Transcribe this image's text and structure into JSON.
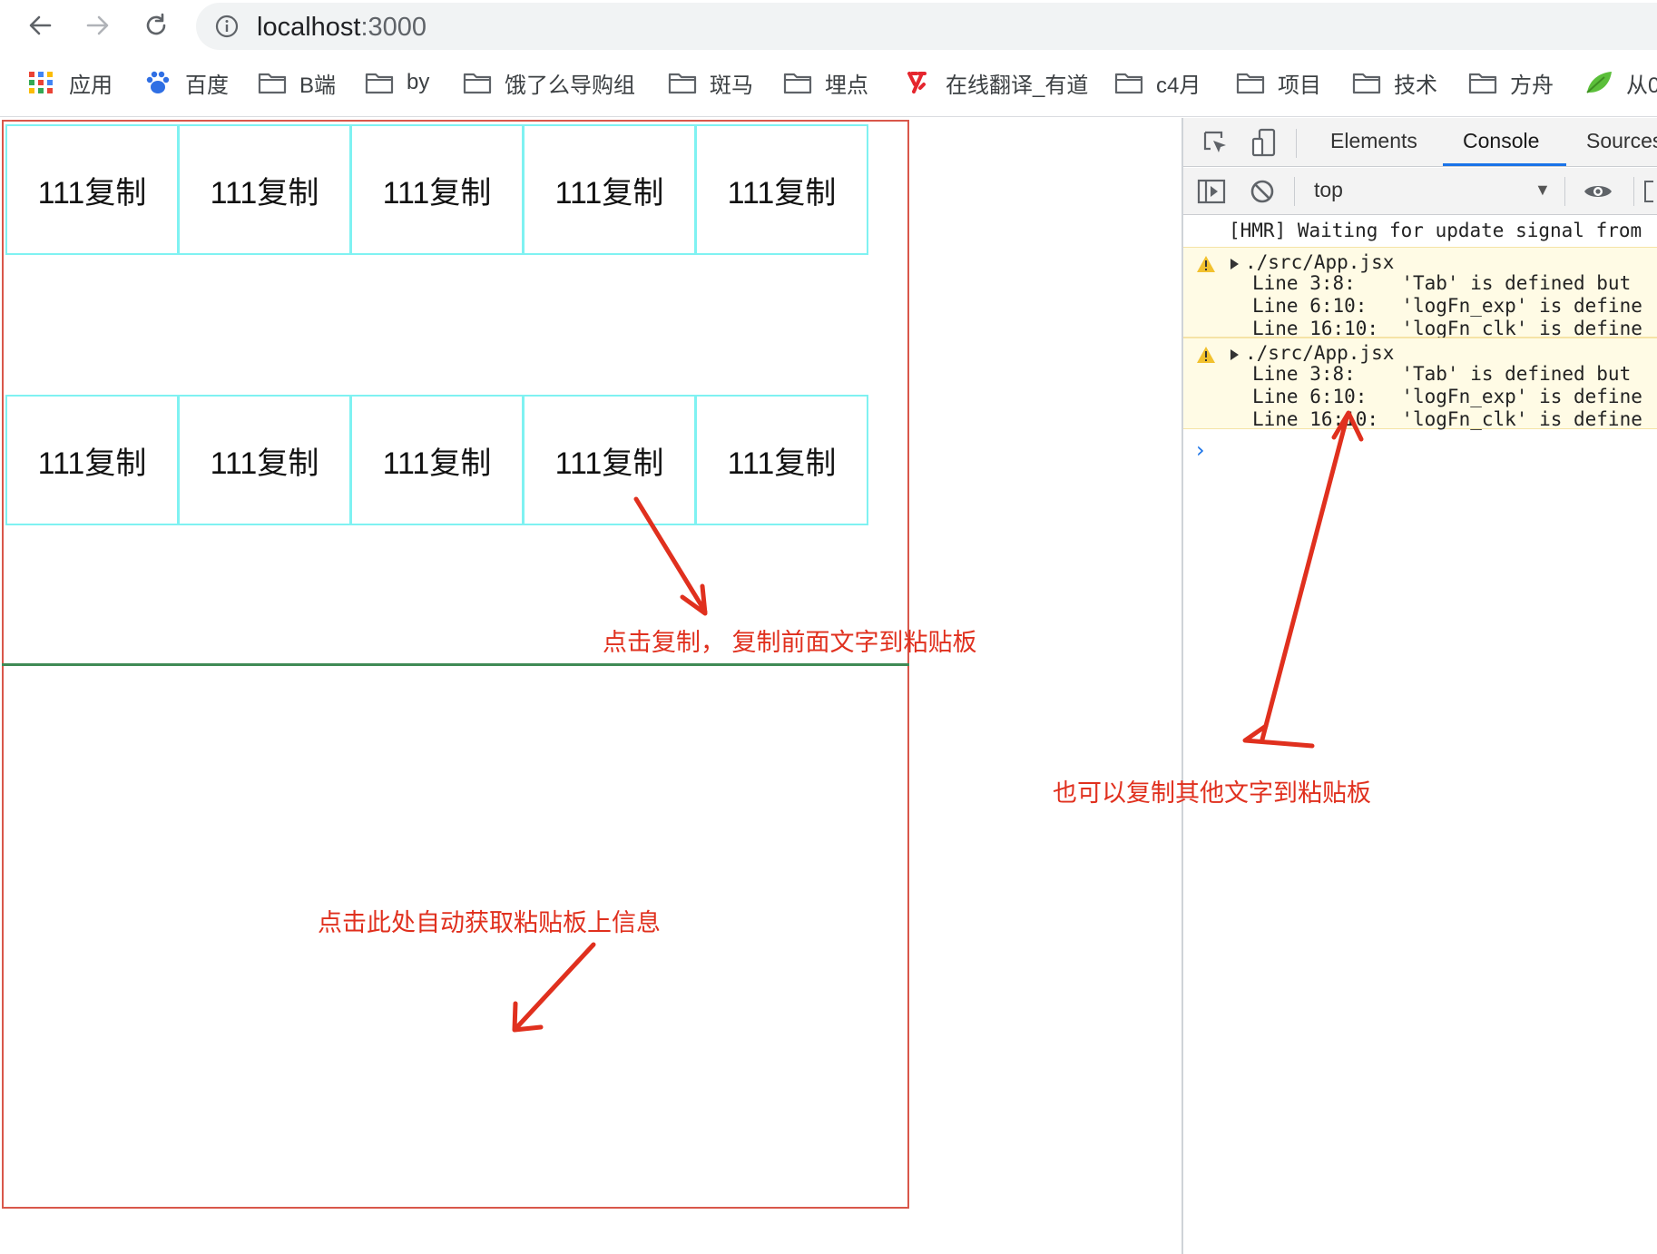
{
  "browser": {
    "url_host": "localhost",
    "url_port": ":3000",
    "nav_icons": [
      "back-arrow-icon",
      "forward-arrow-icon",
      "reload-icon",
      "info-icon"
    ],
    "bookmarks": [
      {
        "label": "应用",
        "icon": "apps-grid-icon"
      },
      {
        "label": "百度",
        "icon": "baidu-paw-icon"
      },
      {
        "label": "B端",
        "icon": "folder-icon"
      },
      {
        "label": "by",
        "icon": "folder-icon"
      },
      {
        "label": "饿了么导购组",
        "icon": "folder-icon"
      },
      {
        "label": "斑马",
        "icon": "folder-icon"
      },
      {
        "label": "埋点",
        "icon": "folder-icon"
      },
      {
        "label": "在线翻译_有道",
        "icon": "youdao-icon"
      },
      {
        "label": "c4月",
        "icon": "folder-icon"
      },
      {
        "label": "项目",
        "icon": "folder-icon"
      },
      {
        "label": "技术",
        "icon": "folder-icon"
      },
      {
        "label": "方舟",
        "icon": "folder-icon"
      },
      {
        "label": "从0",
        "icon": "leaf-icon"
      }
    ]
  },
  "app": {
    "rows": [
      [
        "111复制",
        "111复制",
        "111复制",
        "111复制",
        "111复制"
      ],
      [
        "111复制",
        "111复制",
        "111复制",
        "111复制",
        "111复制"
      ]
    ]
  },
  "devtools": {
    "tabs": [
      "Elements",
      "Console",
      "Sources"
    ],
    "active_tab": "Console",
    "context": "top",
    "log": "[HMR] Waiting for update signal from",
    "warnings": [
      {
        "file": "./src/App.jsx",
        "lines": [
          "Line 3:8:    'Tab' is defined but",
          "Line 6:10:   'logFn_exp' is define",
          "Line 16:10:  'logFn_clk' is define"
        ]
      },
      {
        "file": "./src/App.jsx",
        "lines": [
          "Line 3:8:    'Tab' is defined but",
          "Line 6:10:   'logFn_exp' is define",
          "Line 16:10:  'logFn_clk' is define"
        ]
      }
    ],
    "prompt": "›"
  },
  "annotations": {
    "copy_hint": "点击复制， 复制前面文字到粘贴板",
    "other_copy_hint": "也可以复制其他文字到粘贴板",
    "paste_hint": "点击此处自动获取粘贴板上信息",
    "color": "#e0301e"
  }
}
